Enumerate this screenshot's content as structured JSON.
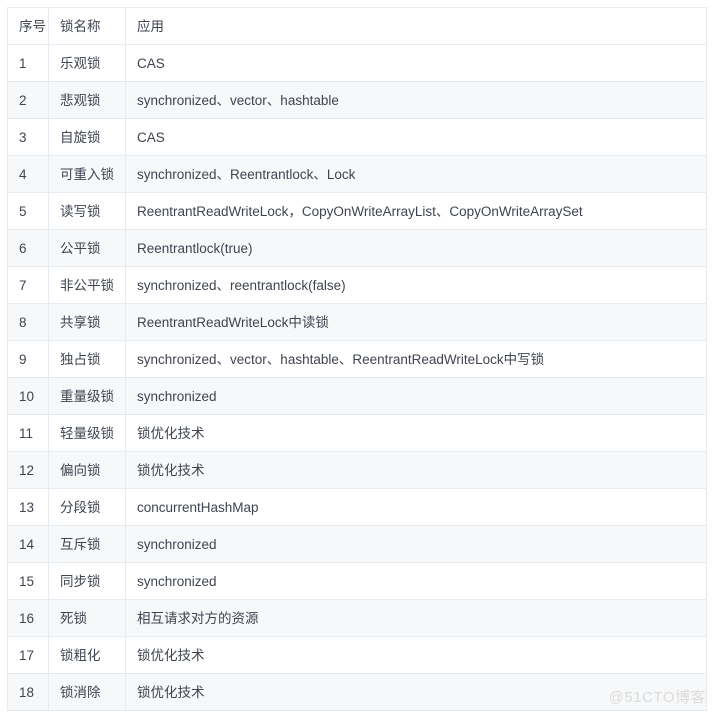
{
  "table": {
    "columns": [
      {
        "key": "index",
        "label": "序号"
      },
      {
        "key": "name",
        "label": "锁名称"
      },
      {
        "key": "app",
        "label": "应用"
      }
    ],
    "rows": [
      {
        "index": "1",
        "name": "乐观锁",
        "app": "CAS"
      },
      {
        "index": "2",
        "name": "悲观锁",
        "app": "synchronized、vector、hashtable"
      },
      {
        "index": "3",
        "name": "自旋锁",
        "app": "CAS"
      },
      {
        "index": "4",
        "name": "可重入锁",
        "app": "synchronized、Reentrantlock、Lock"
      },
      {
        "index": "5",
        "name": "读写锁",
        "app": "ReentrantReadWriteLock，CopyOnWriteArrayList、CopyOnWriteArraySet"
      },
      {
        "index": "6",
        "name": "公平锁",
        "app": "Reentrantlock(true)"
      },
      {
        "index": "7",
        "name": "非公平锁",
        "app": "synchronized、reentrantlock(false)"
      },
      {
        "index": "8",
        "name": "共享锁",
        "app": "ReentrantReadWriteLock中读锁"
      },
      {
        "index": "9",
        "name": "独占锁",
        "app": "synchronized、vector、hashtable、ReentrantReadWriteLock中写锁"
      },
      {
        "index": "10",
        "name": "重量级锁",
        "app": "synchronized"
      },
      {
        "index": "11",
        "name": "轻量级锁",
        "app": "锁优化技术"
      },
      {
        "index": "12",
        "name": "偏向锁",
        "app": "锁优化技术"
      },
      {
        "index": "13",
        "name": "分段锁",
        "app": "concurrentHashMap"
      },
      {
        "index": "14",
        "name": "互斥锁",
        "app": "synchronized"
      },
      {
        "index": "15",
        "name": "同步锁",
        "app": "synchronized"
      },
      {
        "index": "16",
        "name": "死锁",
        "app": "相互请求对方的资源"
      },
      {
        "index": "17",
        "name": "锁粗化",
        "app": "锁优化技术"
      },
      {
        "index": "18",
        "name": "锁消除",
        "app": "锁优化技术"
      }
    ]
  },
  "watermark": {
    "text": "@51CTO博客"
  },
  "colors": {
    "border": "#e6ebf1",
    "row_stripe": "#f7f8f9",
    "row_base": "#ffffff",
    "text": "#3f4450",
    "watermark": "#dcdcdc"
  }
}
